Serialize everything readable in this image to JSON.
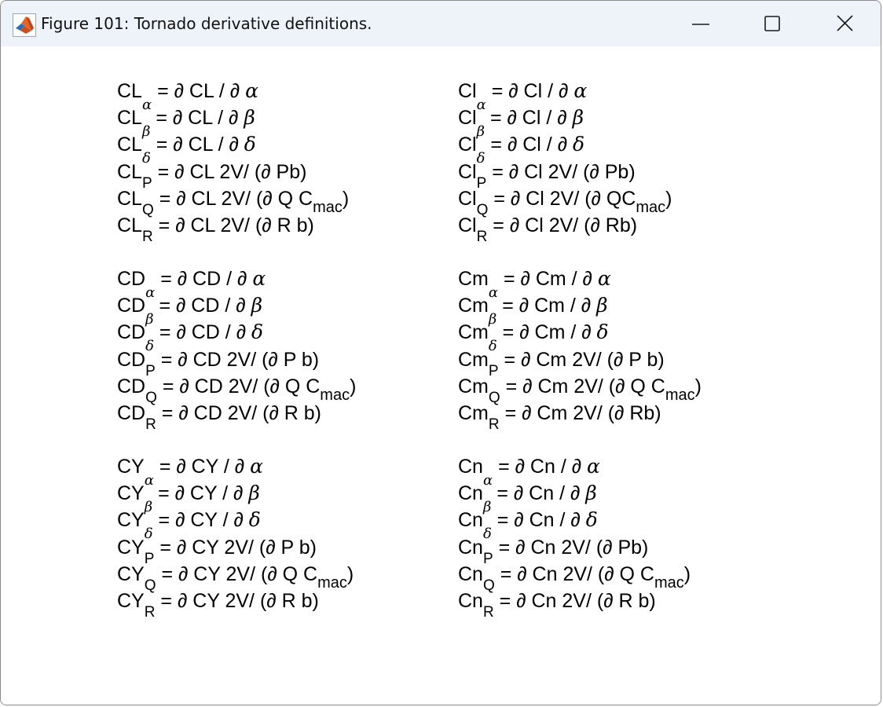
{
  "window": {
    "title": "Figure 101: Tornado derivative definitions.",
    "app_icon": "matlab-logo-icon",
    "controls": [
      "minimize-icon",
      "maximize-icon",
      "close-icon"
    ]
  },
  "blocks": [
    {
      "items": [
        {
          "base": "CL",
          "sub": "α",
          "sub_kind": "greek",
          "rhs": " = ∂ CL / ∂ ",
          "greek": "α",
          "tail": "",
          "mac": "",
          "close": ""
        },
        {
          "base": "CL",
          "sub": "β",
          "sub_kind": "greek",
          "rhs": " = ∂ CL / ∂ ",
          "greek": "β",
          "tail": "",
          "mac": "",
          "close": ""
        },
        {
          "base": "CL",
          "sub": "δ",
          "sub_kind": "greek",
          "rhs": " = ∂ CL / ∂ ",
          "greek": "δ",
          "tail": "",
          "mac": "",
          "close": ""
        },
        {
          "base": "CL",
          "sub": "P",
          "sub_kind": "latin",
          "rhs": " = ∂ CL 2V/ (∂ Pb)",
          "greek": "",
          "tail": "",
          "mac": "",
          "close": ""
        },
        {
          "base": "CL",
          "sub": "Q",
          "sub_kind": "latin",
          "rhs": " = ∂ CL 2V/ (∂ Q C",
          "greek": "",
          "tail": "",
          "mac": "mac",
          "close": ")"
        },
        {
          "base": "CL",
          "sub": "R",
          "sub_kind": "latin",
          "rhs": " = ∂ CL 2V/ (∂ R b)",
          "greek": "",
          "tail": "",
          "mac": "",
          "close": ""
        }
      ]
    },
    {
      "items": [
        {
          "base": "Cl",
          "sub": "α",
          "sub_kind": "greek",
          "rhs": " = ∂ Cl / ∂ ",
          "greek": "α",
          "tail": "",
          "mac": "",
          "close": ""
        },
        {
          "base": "Cl",
          "sub": "β",
          "sub_kind": "greek",
          "rhs": " = ∂ Cl / ∂ ",
          "greek": "β",
          "tail": "",
          "mac": "",
          "close": ""
        },
        {
          "base": "Cl",
          "sub": "δ",
          "sub_kind": "greek",
          "rhs": " = ∂ Cl / ∂ ",
          "greek": "δ",
          "tail": "",
          "mac": "",
          "close": ""
        },
        {
          "base": "Cl",
          "sub": "P",
          "sub_kind": "latin",
          "rhs": " = ∂ Cl 2V/ (∂ Pb)",
          "greek": "",
          "tail": "",
          "mac": "",
          "close": ""
        },
        {
          "base": "Cl",
          "sub": "Q",
          "sub_kind": "latin",
          "rhs": " = ∂ Cl 2V/ (∂ QC",
          "greek": "",
          "tail": "",
          "mac": "mac",
          "close": ")"
        },
        {
          "base": "Cl",
          "sub": "R",
          "sub_kind": "latin",
          "rhs": " = ∂ Cl 2V/ (∂ Rb)",
          "greek": "",
          "tail": "",
          "mac": "",
          "close": ""
        }
      ]
    },
    {
      "items": [
        {
          "base": "CD",
          "sub": "α",
          "sub_kind": "greek",
          "rhs": " = ∂ CD / ∂ ",
          "greek": "α",
          "tail": "",
          "mac": "",
          "close": ""
        },
        {
          "base": "CD",
          "sub": "β",
          "sub_kind": "greek",
          "rhs": " = ∂ CD / ∂ ",
          "greek": "β",
          "tail": "",
          "mac": "",
          "close": ""
        },
        {
          "base": "CD",
          "sub": "δ",
          "sub_kind": "greek",
          "rhs": " = ∂ CD / ∂ ",
          "greek": "δ",
          "tail": "",
          "mac": "",
          "close": ""
        },
        {
          "base": "CD",
          "sub": "P",
          "sub_kind": "latin",
          "rhs": " = ∂ CD 2V/ (∂ P b)",
          "greek": "",
          "tail": "",
          "mac": "",
          "close": ""
        },
        {
          "base": "CD",
          "sub": "Q",
          "sub_kind": "latin",
          "rhs": " = ∂ CD 2V/ (∂ Q C",
          "greek": "",
          "tail": "",
          "mac": "mac",
          "close": ")"
        },
        {
          "base": "CD",
          "sub": "R",
          "sub_kind": "latin",
          "rhs": " = ∂ CD 2V/ (∂ R b)",
          "greek": "",
          "tail": "",
          "mac": "",
          "close": ""
        }
      ]
    },
    {
      "items": [
        {
          "base": "Cm",
          "sub": "α",
          "sub_kind": "greek",
          "rhs": " = ∂ Cm / ∂ ",
          "greek": "α",
          "tail": "",
          "mac": "",
          "close": ""
        },
        {
          "base": "Cm",
          "sub": "β",
          "sub_kind": "greek",
          "rhs": " = ∂ Cm / ∂ ",
          "greek": "β",
          "tail": "",
          "mac": "",
          "close": ""
        },
        {
          "base": "Cm",
          "sub": "δ",
          "sub_kind": "greek",
          "rhs": " = ∂ Cm / ∂ ",
          "greek": "δ",
          "tail": "",
          "mac": "",
          "close": ""
        },
        {
          "base": "Cm",
          "sub": "P",
          "sub_kind": "latin",
          "rhs": " = ∂ Cm 2V/ (∂ P b)",
          "greek": "",
          "tail": "",
          "mac": "",
          "close": ""
        },
        {
          "base": "Cm",
          "sub": "Q",
          "sub_kind": "latin",
          "rhs": " = ∂ Cm 2V/ (∂ Q C",
          "greek": "",
          "tail": "",
          "mac": "mac",
          "close": ")"
        },
        {
          "base": "Cm",
          "sub": "R",
          "sub_kind": "latin",
          "rhs": " = ∂ Cm 2V/ (∂ Rb)",
          "greek": "",
          "tail": "",
          "mac": "",
          "close": ""
        }
      ]
    },
    {
      "items": [
        {
          "base": "CY",
          "sub": "α",
          "sub_kind": "greek",
          "rhs": " = ∂ CY / ∂ ",
          "greek": "α",
          "tail": "",
          "mac": "",
          "close": ""
        },
        {
          "base": "CY",
          "sub": "β",
          "sub_kind": "greek",
          "rhs": " = ∂ CY / ∂ ",
          "greek": "β",
          "tail": "",
          "mac": "",
          "close": ""
        },
        {
          "base": "CY",
          "sub": "δ",
          "sub_kind": "greek",
          "rhs": " = ∂ CY / ∂ ",
          "greek": "δ",
          "tail": "",
          "mac": "",
          "close": ""
        },
        {
          "base": "CY",
          "sub": "P",
          "sub_kind": "latin",
          "rhs": " = ∂ CY 2V/ (∂ P b)",
          "greek": "",
          "tail": "",
          "mac": "",
          "close": ""
        },
        {
          "base": "CY",
          "sub": "Q",
          "sub_kind": "latin",
          "rhs": " = ∂ CY 2V/ (∂ Q C",
          "greek": "",
          "tail": "",
          "mac": "mac",
          "close": ")"
        },
        {
          "base": "CY",
          "sub": "R",
          "sub_kind": "latin",
          "rhs": " = ∂ CY 2V/ (∂ R b)",
          "greek": "",
          "tail": "",
          "mac": "",
          "close": ""
        }
      ]
    },
    {
      "items": [
        {
          "base": "Cn",
          "sub": "α",
          "sub_kind": "greek",
          "rhs": " = ∂ Cn / ∂ ",
          "greek": "α",
          "tail": "",
          "mac": "",
          "close": ""
        },
        {
          "base": "Cn",
          "sub": "β",
          "sub_kind": "greek",
          "rhs": " = ∂ Cn / ∂ ",
          "greek": "β",
          "tail": "",
          "mac": "",
          "close": ""
        },
        {
          "base": "Cn",
          "sub": "δ",
          "sub_kind": "greek",
          "rhs": " = ∂ Cn / ∂ ",
          "greek": "δ",
          "tail": "",
          "mac": "",
          "close": ""
        },
        {
          "base": "Cn",
          "sub": "P",
          "sub_kind": "latin",
          "rhs": " = ∂ Cn 2V/ (∂ Pb)",
          "greek": "",
          "tail": "",
          "mac": "",
          "close": ""
        },
        {
          "base": "Cn",
          "sub": "Q",
          "sub_kind": "latin",
          "rhs": " = ∂ Cn 2V/ (∂ Q C",
          "greek": "",
          "tail": "",
          "mac": "mac",
          "close": ")"
        },
        {
          "base": "Cn",
          "sub": "R",
          "sub_kind": "latin",
          "rhs": " = ∂ Cn 2V/ (∂ R b)",
          "greek": "",
          "tail": "",
          "mac": "",
          "close": ""
        }
      ]
    }
  ]
}
